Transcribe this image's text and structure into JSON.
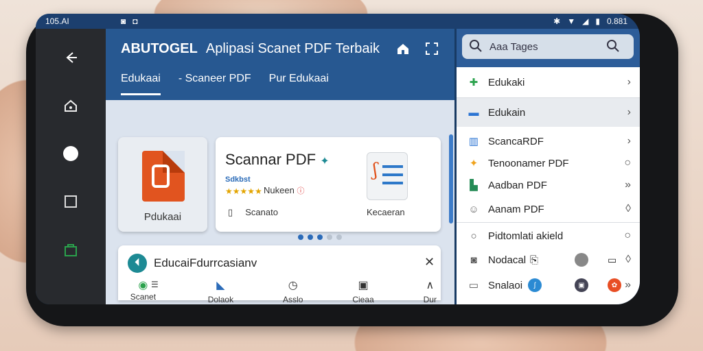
{
  "status": {
    "time": "105.AI",
    "battery": "0.881"
  },
  "app": {
    "brand": "ABUTOGEL",
    "title": "Aplipasi Scanеt PDF Terbaik",
    "tabs": [
      {
        "label": "Edukaai"
      },
      {
        "label": "- Scaneer PDF"
      },
      {
        "label": "Pur Edukaai"
      }
    ]
  },
  "cards": {
    "small_label": "Pdukaai",
    "main_title": "Scannar PDF",
    "main_sub": "Sdkbst",
    "main_rating_text": "Nukeen",
    "main_footer_left": "Scanato",
    "main_footer_right": "Kecaeran"
  },
  "bottom": {
    "title": "EducaiFdurrcasianv",
    "nav": [
      {
        "label": "Scanet"
      },
      {
        "label": "Dolaok"
      },
      {
        "label": "Asslo"
      },
      {
        "label": "Cieaa"
      },
      {
        "label": "Dur"
      }
    ]
  },
  "side": {
    "search_placeholder": "Aaa Tages",
    "items": [
      {
        "label": "Edukaki",
        "color": "#2aa24c"
      },
      {
        "label": "Edukain",
        "color": "#2b74d3"
      },
      {
        "label": "ScancaRDF",
        "color": "#2b74d3"
      },
      {
        "label": "Tenoonamer PDF",
        "color": "#f0a31c"
      },
      {
        "label": "Aadban PDF",
        "color": "#248b55"
      },
      {
        "label": "Aanam PDF",
        "color": "#555555"
      },
      {
        "label": "Pidtomlati akield",
        "color": "#555555"
      },
      {
        "label": "Nodacal",
        "color": "#555555"
      },
      {
        "label": "Snalaoi",
        "color": "#555555"
      }
    ]
  },
  "colors": {
    "appbar": "#275891",
    "accent": "#2b6bb8",
    "pdf": "#e1541f"
  }
}
